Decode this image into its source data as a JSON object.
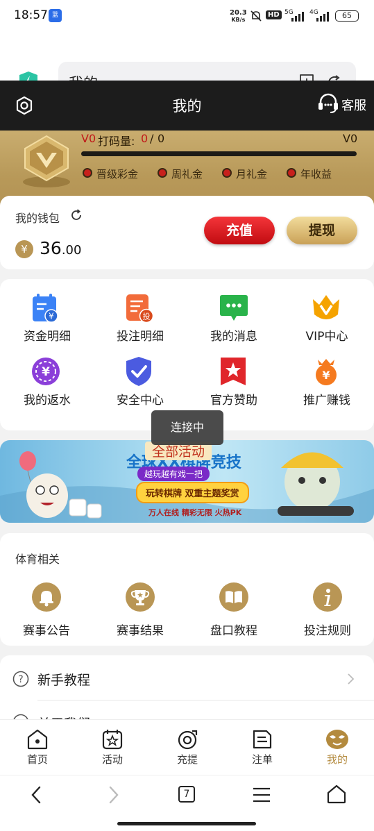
{
  "status_bar": {
    "time": "18:57",
    "app_badge": "蓝",
    "net_speed": "20.3",
    "net_unit": "KB/s",
    "hd": "HD",
    "signal1": "5G",
    "signal2": "4G",
    "battery": "65"
  },
  "address_bar": {
    "title": "我的",
    "icons": [
      "shield-icon",
      "add-bookmark-icon",
      "refresh-icon"
    ]
  },
  "header": {
    "title": "我的",
    "service_label": "客服",
    "icons": [
      "settings-icon",
      "headset-icon"
    ]
  },
  "vip": {
    "level": "V0",
    "progress_label": "打码量:",
    "progress_current": "0",
    "progress_sep": "/",
    "progress_total": "0",
    "next_level": "V0",
    "progress": 0,
    "bonuses": [
      "晋级彩金",
      "周礼金",
      "月礼金",
      "年收益"
    ]
  },
  "wallet": {
    "label": "我的钱包",
    "currency": "¥",
    "amount_int": "36",
    "amount_dec": ".00",
    "recharge": "充值",
    "withdraw": "提现"
  },
  "features": [
    {
      "label": "资金明细",
      "icon": "fund-details-icon",
      "color": "#3b82f6"
    },
    {
      "label": "投注明细",
      "icon": "bet-details-icon",
      "color": "#f26b3a"
    },
    {
      "label": "我的消息",
      "icon": "message-icon",
      "color": "#29b34a"
    },
    {
      "label": "VIP中心",
      "icon": "vip-crown-icon",
      "color": "#f5a300"
    },
    {
      "label": "我的返水",
      "icon": "rebate-icon",
      "color": "#8b3fd9"
    },
    {
      "label": "安全中心",
      "icon": "security-shield-icon",
      "color": "#4b5be0"
    },
    {
      "label": "官方赞助",
      "icon": "sponsor-star-icon",
      "color": "#e0262b"
    },
    {
      "label": "推广赚钱",
      "icon": "promote-money-icon",
      "color": "#f57a1f"
    }
  ],
  "banner": {
    "tag": "全部活动",
    "headline": "全球XX棋牌竞技",
    "sub1": "越玩越有戏一把",
    "sub2": "玩转棋牌 双重主题奖赏",
    "sub3": "万人在线  精彩无限  火热PK"
  },
  "toast": "连接中",
  "sports": {
    "title": "体育相关",
    "items": [
      {
        "label": "赛事公告",
        "icon": "bell-icon"
      },
      {
        "label": "赛事结果",
        "icon": "trophy-icon"
      },
      {
        "label": "盘口教程",
        "icon": "book-icon"
      },
      {
        "label": "投注规则",
        "icon": "info-icon"
      }
    ]
  },
  "help": {
    "label": "新手教程",
    "next_label": "关于我们"
  },
  "bottom_nav": [
    {
      "label": "首页",
      "icon": "home-icon",
      "active": false
    },
    {
      "label": "活动",
      "icon": "activity-icon",
      "active": false
    },
    {
      "label": "充提",
      "icon": "deposit-icon",
      "active": false
    },
    {
      "label": "注单",
      "icon": "bet-slip-icon",
      "active": false
    },
    {
      "label": "我的",
      "icon": "profile-mascot-icon",
      "active": true
    }
  ],
  "system_nav": {
    "tab_count": "7"
  },
  "colors": {
    "gold": "#b99655",
    "red": "#e0151b",
    "dark": "#1c1c1c",
    "active": "#b38a3e"
  }
}
